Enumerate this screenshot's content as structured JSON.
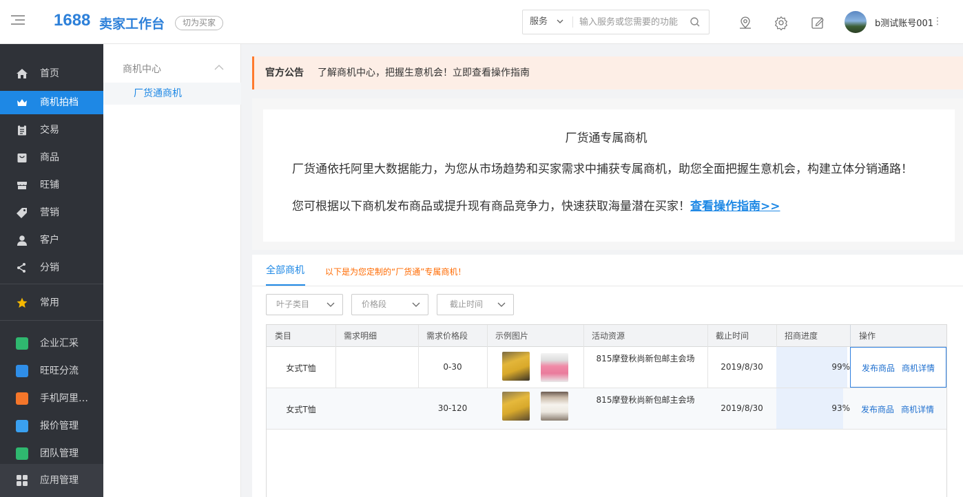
{
  "header": {
    "logo_num": "1688",
    "logo_text": "卖家工作台",
    "switch_label": "切为买家",
    "search_category": "服务",
    "search_placeholder": "输入服务或您需要的功能",
    "username": "b测试账号001",
    "more": "⋮"
  },
  "sidebar": {
    "items": [
      {
        "label": "首页",
        "icon": "home-icon"
      },
      {
        "label": "商机拍档",
        "icon": "crown-icon"
      },
      {
        "label": "交易",
        "icon": "clipboard-icon"
      },
      {
        "label": "商品",
        "icon": "product-icon"
      },
      {
        "label": "旺铺",
        "icon": "shop-icon"
      },
      {
        "label": "营销",
        "icon": "tag-icon"
      },
      {
        "label": "客户",
        "icon": "user-icon"
      },
      {
        "label": "分销",
        "icon": "distribute-icon"
      }
    ],
    "common": "常用",
    "apps": [
      {
        "label": "企业汇采",
        "color": "#2fb86f"
      },
      {
        "label": "旺旺分流",
        "color": "#2f8ee8"
      },
      {
        "label": "手机阿里…",
        "color": "#f4762a"
      },
      {
        "label": "报价管理",
        "color": "#3aa0f0"
      },
      {
        "label": "团队管理",
        "color": "#2fb86f"
      }
    ],
    "app_manage": "应用管理"
  },
  "subnav": {
    "group": "商机中心",
    "item": "厂货通商机"
  },
  "notice": {
    "tag": "官方公告",
    "message": "了解商机中心，把握生意机会！立即查看操作指南"
  },
  "intro": {
    "title": "厂货通专属商机",
    "para1": "厂货通依托阿里大数据能力，为您从市场趋势和买家需求中捕获专属商机，助您全面把握生意机会，构建立体分销通路！",
    "para2": "您可根据以下商机发布商品或提升现有商品竞争力，快速获取海量潜在买家！",
    "link": "查看操作指南>>"
  },
  "tabs": {
    "active": "全部商机",
    "hint": "以下是为您定制的“厂货通”专属商机！"
  },
  "filters": [
    "叶子类目",
    "价格段",
    "截止时间"
  ],
  "table": {
    "headers": [
      "类目",
      "需求明细",
      "需求价格段",
      "示例图片",
      "活动资源",
      "截止时间",
      "招商进度",
      "操作"
    ],
    "rows": [
      {
        "category": "女式T恤",
        "detail": "",
        "price": "0-30",
        "resource": "815摩登秋尚新包邮主会场",
        "deadline": "2019/8/30",
        "progress": 99,
        "progress_label": "99%",
        "op1": "发布商品",
        "op2": "商机详情"
      },
      {
        "category": "女式T恤",
        "detail": "",
        "price": "30-120",
        "resource": "815摩登秋尚新包邮主会场",
        "deadline": "2019/8/30",
        "progress": 93,
        "progress_label": "93%",
        "op1": "发布商品",
        "op2": "商机详情"
      }
    ]
  },
  "colors": {
    "accent": "#1e88e5",
    "sidebar_bg": "#2f3238",
    "notice_bg": "#fdeee6",
    "hint": "#ff6a00"
  }
}
